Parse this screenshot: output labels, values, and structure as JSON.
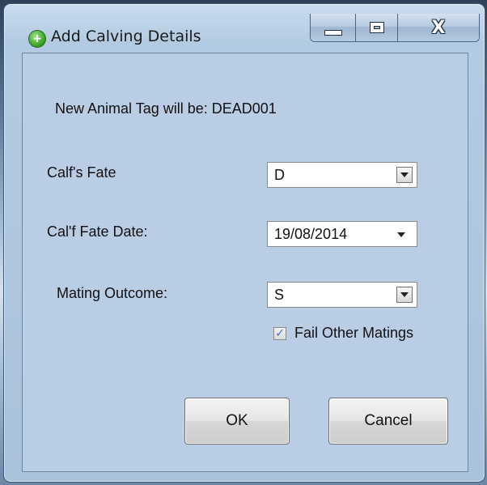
{
  "window": {
    "title": "Add Calving Details",
    "icon": "green-add-icon",
    "caption": {
      "minimize": "minimize",
      "maximize": "maximize",
      "close": "X"
    }
  },
  "form": {
    "info_text": "New Animal Tag will be: DEAD001",
    "calf_fate_label": "Calf's Fate",
    "calf_fate_value": "D",
    "calf_fate_date_label": "Cal'f Fate Date:",
    "calf_fate_date_value": "19/08/2014",
    "mating_outcome_label": "Mating Outcome:",
    "mating_outcome_value": "S",
    "fail_other_matings_label": "Fail Other Matings",
    "fail_other_matings_checked": true
  },
  "buttons": {
    "ok": "OK",
    "cancel": "Cancel"
  },
  "colors": {
    "client_bg": "#b9cde5",
    "accent_check": "#3a6fcc"
  }
}
